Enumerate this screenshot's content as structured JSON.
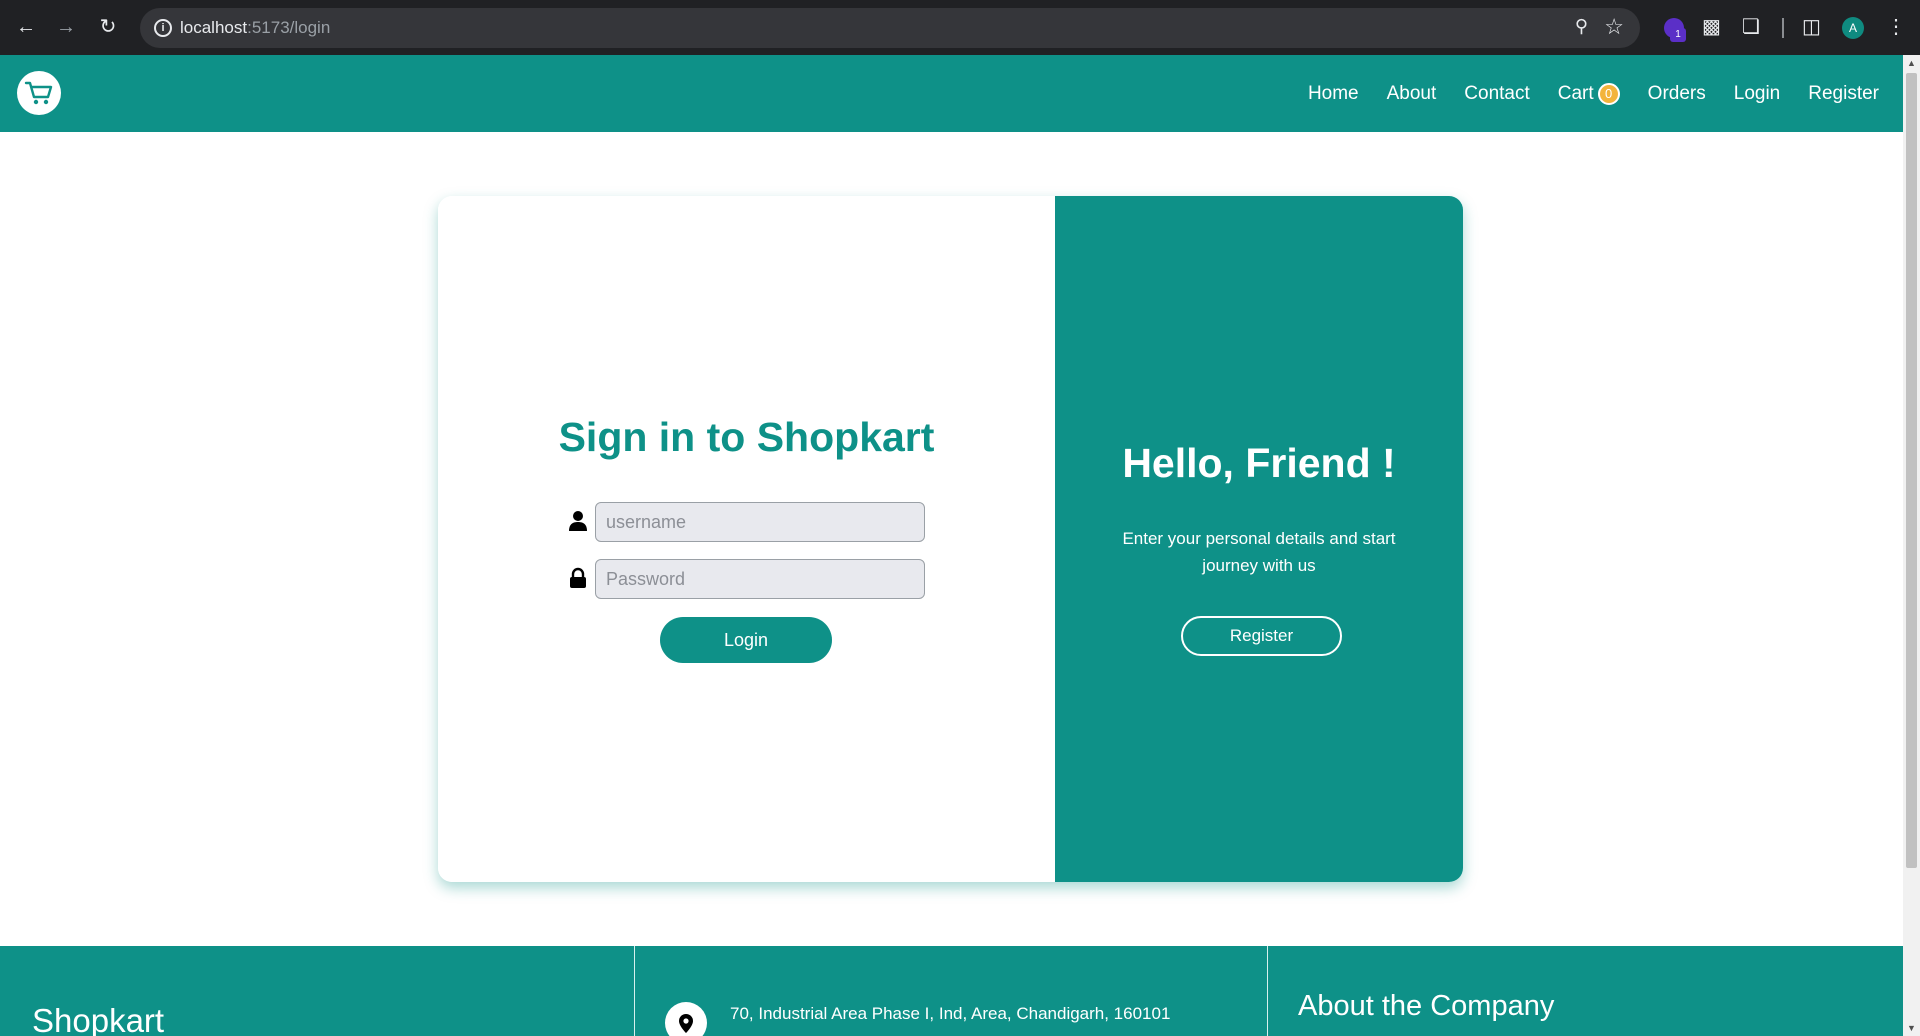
{
  "browser": {
    "url_host": "localhost",
    "url_path": ":5173/login",
    "extension_badge": "1",
    "profile_initial": "A"
  },
  "navbar": {
    "logo_icon": "shopping-cart-icon",
    "links": {
      "home": "Home",
      "about": "About",
      "contact": "Contact",
      "cart": "Cart",
      "cart_count": "0",
      "orders": "Orders",
      "login": "Login",
      "register": "Register"
    }
  },
  "signin": {
    "title": "Sign in to Shopkart",
    "username_placeholder": "username",
    "password_placeholder": "Password",
    "login_label": "Login"
  },
  "welcome": {
    "title": "Hello, Friend !",
    "text": "Enter your personal details and start journey with us",
    "register_label": "Register"
  },
  "footer": {
    "brand": "Shopkart",
    "address": "70, Industrial Area Phase I, Ind, Area, Chandigarh, 160101",
    "about_heading": "About the Company"
  },
  "colors": {
    "brand": "#0e9188",
    "badge": "#f3b43c"
  }
}
